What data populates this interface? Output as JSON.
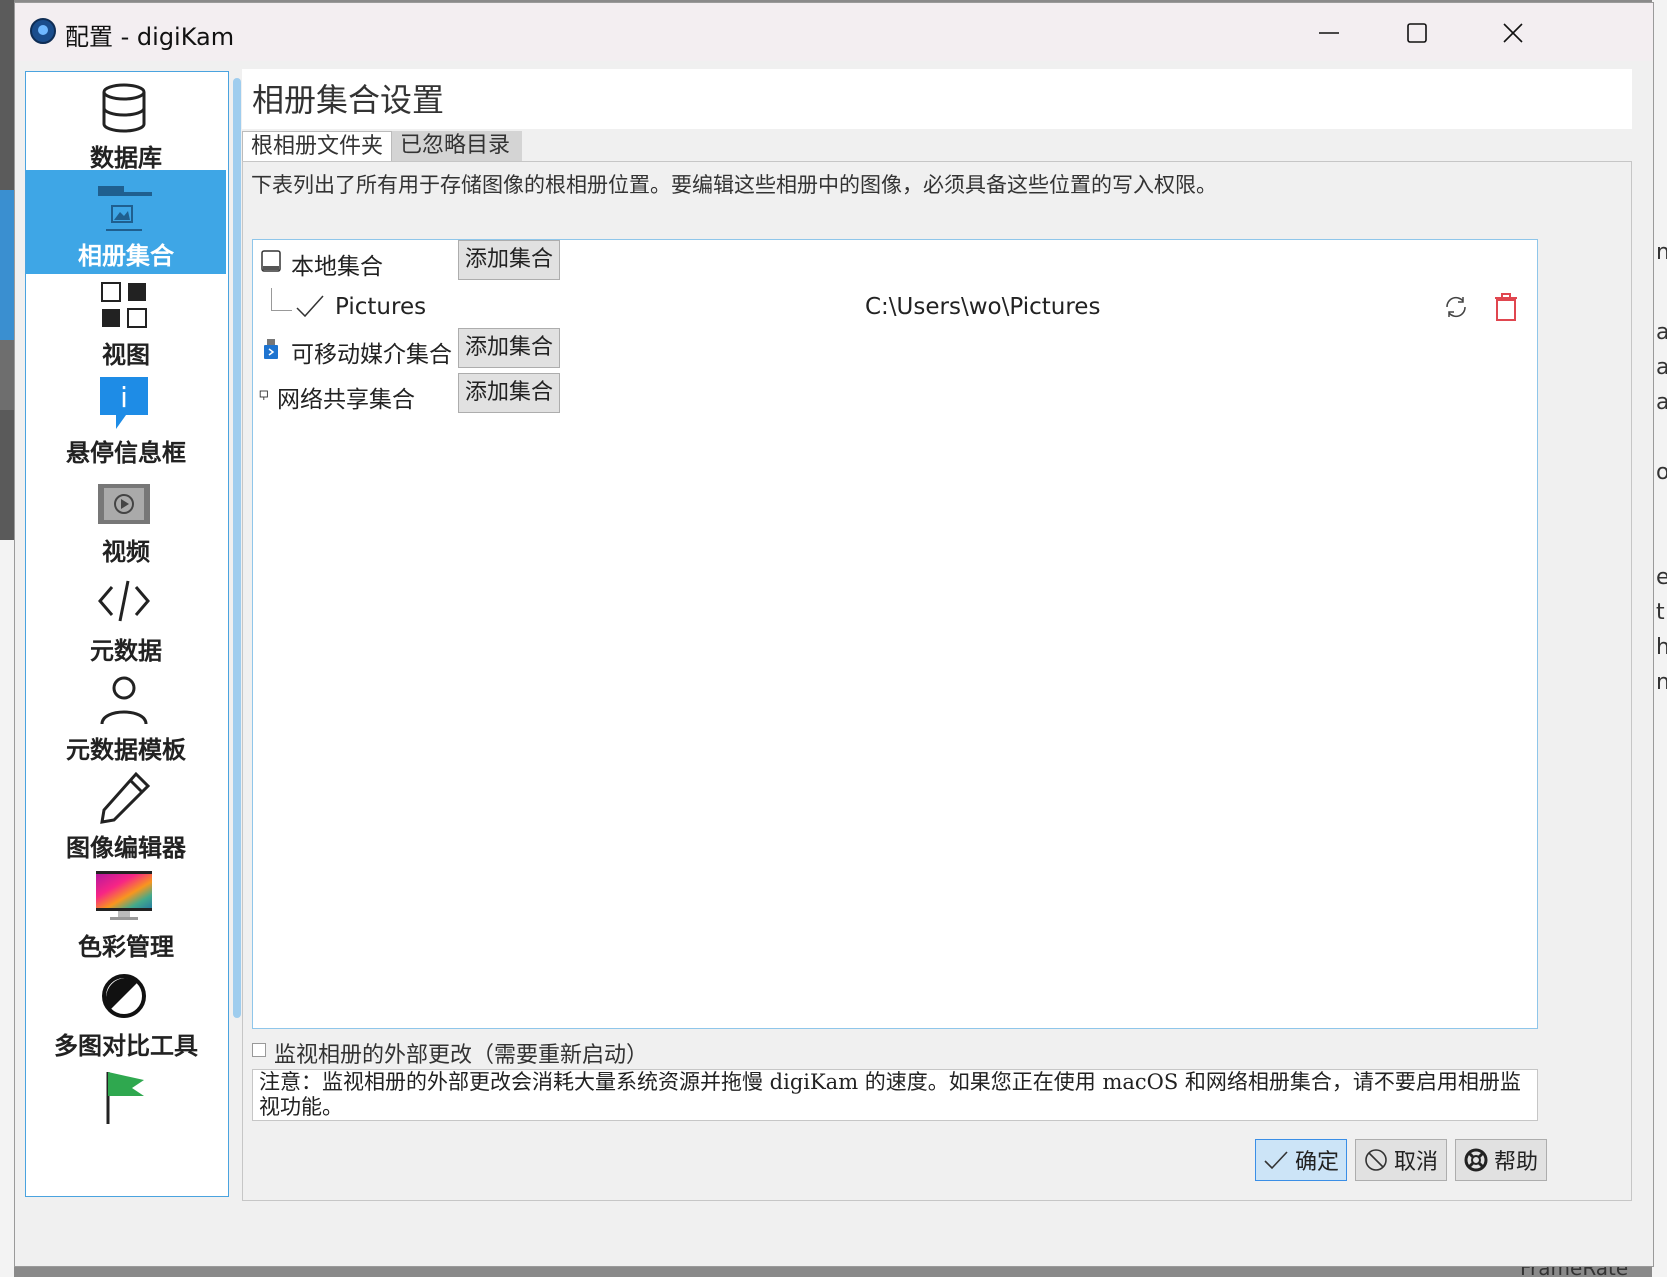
{
  "window": {
    "title": "配置 - digiKam",
    "controls": [
      "minimize",
      "maximize",
      "close"
    ]
  },
  "sidebar": {
    "items": [
      {
        "label": "数据库",
        "icon": "database-icon",
        "selected": false
      },
      {
        "label": "相册集合",
        "icon": "folder-image-icon",
        "selected": true
      },
      {
        "label": "视图",
        "icon": "grid-view-icon",
        "selected": false
      },
      {
        "label": "悬停信息框",
        "icon": "info-tooltip-icon",
        "selected": false
      },
      {
        "label": "视频",
        "icon": "video-icon",
        "selected": false
      },
      {
        "label": "元数据",
        "icon": "code-icon",
        "selected": false
      },
      {
        "label": "元数据模板",
        "icon": "person-icon",
        "selected": false
      },
      {
        "label": "图像编辑器",
        "icon": "pencil-icon",
        "selected": false
      },
      {
        "label": "色彩管理",
        "icon": "color-monitor-icon",
        "selected": false
      },
      {
        "label": "多图对比工具",
        "icon": "contrast-icon",
        "selected": false
      },
      {
        "label": "",
        "icon": "flag-icon",
        "selected": false
      }
    ]
  },
  "page": {
    "title": "相册集合设置",
    "tabs": [
      {
        "label": "根相册文件夹",
        "active": true
      },
      {
        "label": "已忽略目录",
        "active": false
      }
    ],
    "description": "下表列出了所有用于存储图像的根相册位置。要编辑这些相册中的图像，必须具备这些位置的写入权限。"
  },
  "collections": {
    "local": {
      "label": "本地集合",
      "add_button": "添加集合"
    },
    "removable": {
      "label": "可移动媒介集合",
      "add_button": "添加集合"
    },
    "network": {
      "label": "网络共享集合",
      "add_button": "添加集合"
    },
    "entries": [
      {
        "name": "Pictures",
        "path": "C:\\Users\\wo\\Pictures"
      }
    ]
  },
  "monitor": {
    "checkbox_label": "监视相册的外部更改（需要重新启动）",
    "checked": false,
    "note": "注意：监视相册的外部更改会消耗大量系统资源并拖慢 digiKam 的速度。如果您正在使用 macOS 和网络相册集合，请不要启用相册监视功能。"
  },
  "buttons": {
    "ok": "确定",
    "cancel": "取消",
    "help": "帮助"
  },
  "colors": {
    "accent": "#3ea6e6",
    "trash": "#e0464f"
  },
  "background": {
    "bottom_text": "FrameRate"
  }
}
